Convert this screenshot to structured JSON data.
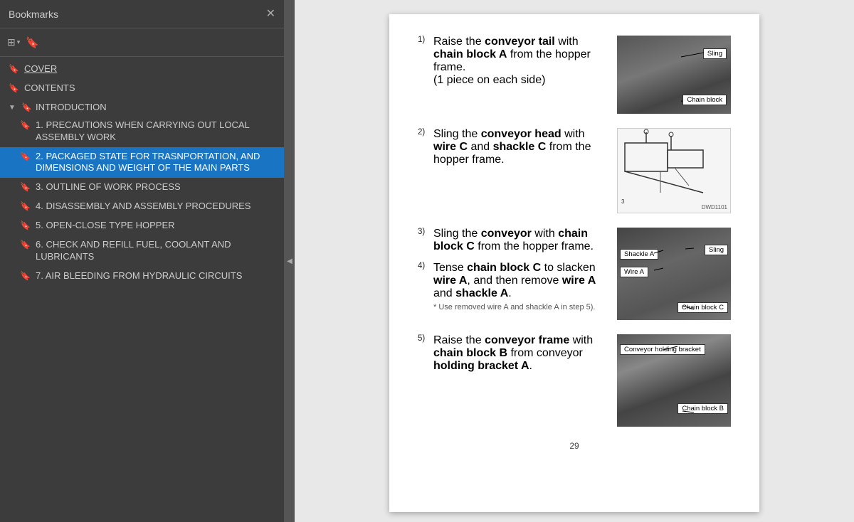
{
  "panel": {
    "title": "Bookmarks",
    "close_label": "✕"
  },
  "toolbar": {
    "layout_icon": "⊞",
    "layout_arrow": "▾",
    "bookmark_icon": "🔖"
  },
  "bookmarks": [
    {
      "id": "cover",
      "label": "COVER",
      "indent": 0,
      "is_link": true,
      "active": false
    },
    {
      "id": "contents",
      "label": "CONTENTS",
      "indent": 0,
      "is_link": false,
      "active": false
    },
    {
      "id": "introduction",
      "label": "INTRODUCTION",
      "indent": 0,
      "is_header": true,
      "active": false
    },
    {
      "id": "item1",
      "label": "1. PRECAUTIONS WHEN CARRYING OUT LOCAL ASSEMBLY WORK",
      "indent": 1,
      "active": false
    },
    {
      "id": "item2",
      "label": "2. PACKAGED STATE FOR TRASNPORTATION, AND DIMENSIONS AND WEIGHT OF THE MAIN PARTS",
      "indent": 1,
      "active": true
    },
    {
      "id": "item3",
      "label": "3. OUTLINE OF WORK PROCESS",
      "indent": 1,
      "active": false
    },
    {
      "id": "item4",
      "label": "4. DISASSEMBLY AND ASSEMBLY PROCEDURES",
      "indent": 1,
      "active": false
    },
    {
      "id": "item5",
      "label": "5. OPEN-CLOSE TYPE HOPPER",
      "indent": 1,
      "active": false
    },
    {
      "id": "item6",
      "label": "6. CHECK AND REFILL FUEL, COOLANT AND LUBRICANTS",
      "indent": 1,
      "active": false
    },
    {
      "id": "item7",
      "label": "7. AIR BLEEDING FROM HYDRAULIC CIRCUITS",
      "indent": 1,
      "active": false
    }
  ],
  "document": {
    "steps": [
      {
        "num": "1)",
        "text": "Raise the conveyor tail with chain block A from the hopper frame. (1 piece on each side)",
        "labels": [
          "Sling",
          "Chain block"
        ]
      },
      {
        "num": "2)",
        "text": "Sling the conveyor head with wire C and shackle C from the hopper frame.",
        "labels": []
      },
      {
        "num": "3)",
        "text": "Sling the conveyor with chain block C from the hopper frame.",
        "labels": []
      },
      {
        "num": "4)",
        "text": "Tense chain block C to slacken wire A, and then remove wire A and shackle A.",
        "note": "* Use removed wire A and shackle A in step 5).",
        "labels": [
          "Shackle A",
          "Sling",
          "Wire A",
          "Chain block C"
        ]
      },
      {
        "num": "5)",
        "text": "Raise the conveyor frame with chain block B from conveyor holding bracket A.",
        "labels": [
          "Conveyor holding bracket",
          "Chain block B"
        ]
      }
    ],
    "page_number": "29",
    "dwg_code": "DWD1101"
  }
}
